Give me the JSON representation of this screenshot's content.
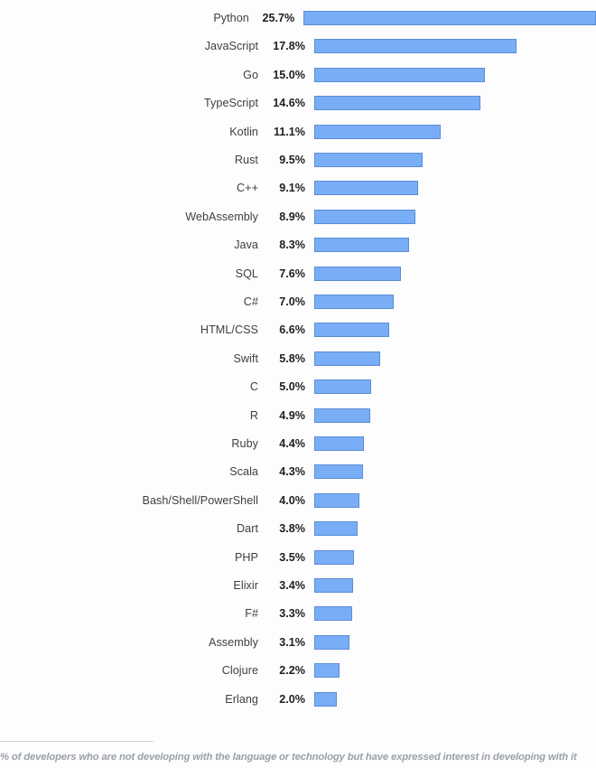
{
  "chart_data": {
    "type": "bar",
    "orientation": "horizontal",
    "title": "",
    "subtitle": "",
    "xlabel": "",
    "ylabel": "",
    "grid": false,
    "legend": false,
    "value_suffix": "%",
    "xlim": [
      0,
      25.7
    ],
    "categories": [
      "Python",
      "JavaScript",
      "Go",
      "TypeScript",
      "Kotlin",
      "Rust",
      "C++",
      "WebAssembly",
      "Java",
      "SQL",
      "C#",
      "HTML/CSS",
      "Swift",
      "C",
      "R",
      "Ruby",
      "Scala",
      "Bash/Shell/PowerShell",
      "Dart",
      "PHP",
      "Elixir",
      "F#",
      "Assembly",
      "Clojure",
      "Erlang"
    ],
    "values": [
      25.7,
      17.8,
      15.0,
      14.6,
      11.1,
      9.5,
      9.1,
      8.9,
      8.3,
      7.6,
      7.0,
      6.6,
      5.8,
      5.0,
      4.9,
      4.4,
      4.3,
      4.0,
      3.8,
      3.5,
      3.4,
      3.3,
      3.1,
      2.2,
      2.0
    ],
    "value_labels": [
      "25.7%",
      "17.8%",
      "15.0%",
      "14.6%",
      "11.1%",
      "9.5%",
      "9.1%",
      "8.9%",
      "8.3%",
      "7.6%",
      "7.0%",
      "6.6%",
      "5.8%",
      "5.0%",
      "4.9%",
      "4.4%",
      "4.3%",
      "4.0%",
      "3.8%",
      "3.5%",
      "3.4%",
      "3.3%",
      "3.1%",
      "2.2%",
      "2.0%"
    ],
    "bar_color": "#79aef6",
    "bar_border_color": "#5b8dd6",
    "background_color": "#fdfdfd",
    "label_color": "#3c4043",
    "value_color": "#202124"
  },
  "footer": {
    "note": "% of developers who are not developing with the language or technology but have expressed interest in developing with it",
    "rule_color": "#d4d4d4",
    "note_color": "#9aa0a6"
  }
}
